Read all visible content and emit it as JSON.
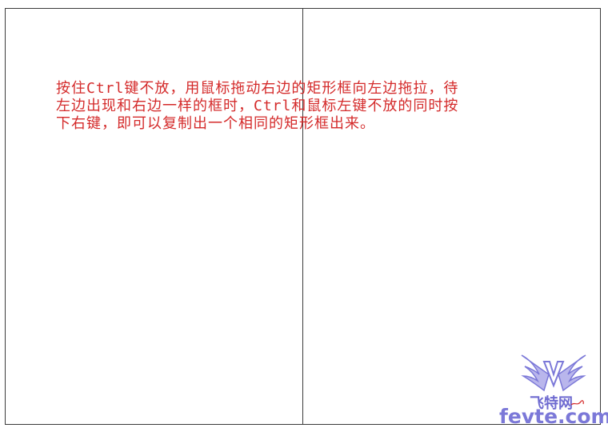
{
  "instruction": {
    "text": "按住Ctrl键不放，用鼠标拖动右边的矩形框向左边拖拉，待\n左边出现和右边一样的框时，Ctrl和鼠标左键不放的同时按\n下右键，即可以复制出一个相同的矩形框出来。",
    "color": "#d42a2a"
  },
  "watermark": {
    "name": "飞特网",
    "site": "fevte.com",
    "icon": "winged-v-logo-icon",
    "color": "#7b78d8"
  },
  "colors": {
    "rect_border": "#3a3a3a",
    "background": "#ffffff"
  }
}
